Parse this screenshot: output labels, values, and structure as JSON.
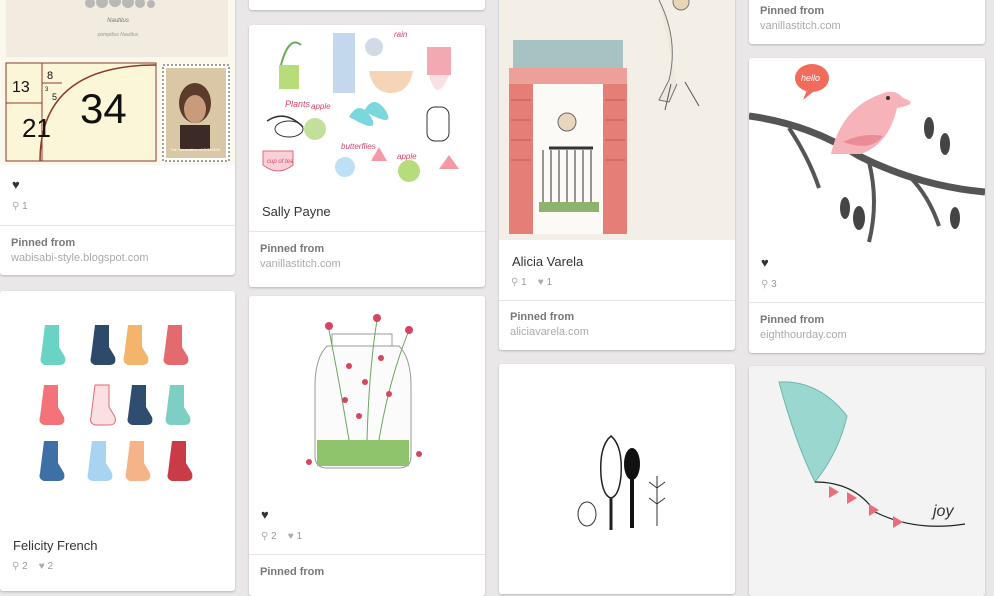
{
  "pins": {
    "nautilus": {
      "nautilus_caption_1": "Nautilus",
      "nautilus_caption_2": "pompilius Nautilus",
      "fib": [
        "13",
        "8",
        "5",
        "34",
        "21",
        "3"
      ],
      "stamp_text": "The Generation of DOMINIK",
      "repin_count": "1",
      "pinned_from": "Pinned from",
      "source": "wabisabi-style.blogspot.com"
    },
    "sally": {
      "description": "Sally Payne",
      "pinned_from": "Pinned from",
      "source": "vanillastitch.com",
      "art_words": [
        "Plants",
        "rain",
        "apple",
        "butterflies",
        "cup of tea",
        "apple"
      ]
    },
    "alicia": {
      "description": "Alicia Varela",
      "repin_count": "1",
      "like_count": "1",
      "pinned_from": "Pinned from",
      "source": "aliciavarela.com"
    },
    "topright": {
      "pinned_from": "Pinned from",
      "source": "vanillastitch.com"
    },
    "bird": {
      "bubble_text": "hello",
      "repin_count": "3",
      "pinned_from": "Pinned from",
      "source": "eighthourday.com"
    },
    "socks": {
      "description": "Felicity French",
      "repin_count": "2",
      "like_count": "2"
    },
    "jar": {
      "repin_count": "2",
      "like_count": "1",
      "pinned_from": "Pinned from"
    },
    "kite": {
      "kite_text": "joy"
    }
  },
  "icons": {
    "heart": "♥",
    "repin": "⚲",
    "like": "♥"
  },
  "colors": {
    "background": "#e9e7e7",
    "card": "#ffffff",
    "text": "#333333",
    "muted": "#999999",
    "pink": "#e88a95",
    "teal": "#8fd3c8"
  }
}
